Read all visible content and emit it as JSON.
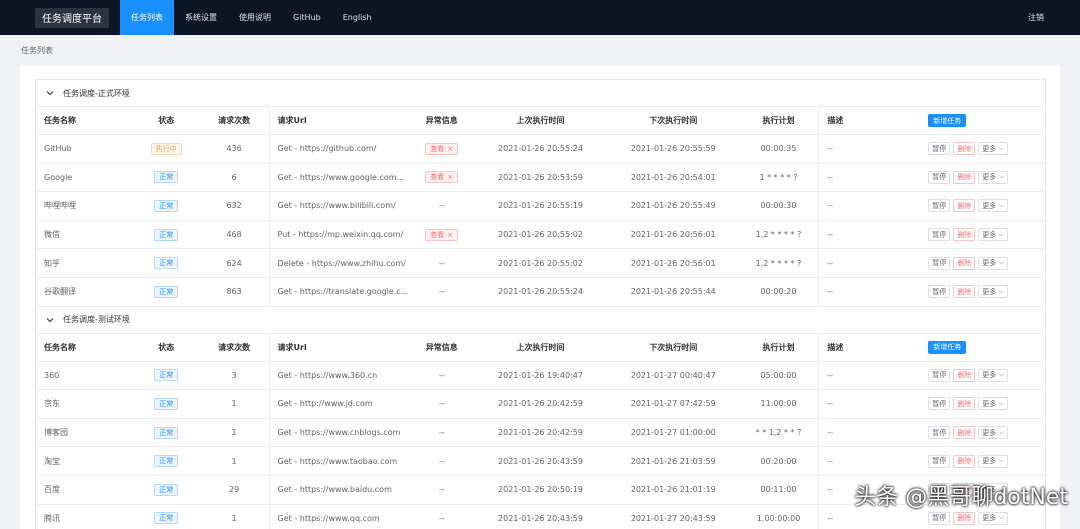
{
  "header": {
    "brand": "任务调度平台",
    "nav": [
      "任务列表",
      "系统设置",
      "使用说明",
      "GitHub",
      "English"
    ],
    "logout": "注销"
  },
  "breadcrumb": "任务列表",
  "columns": [
    "任务名称",
    "状态",
    "请求次数",
    "请求Url",
    "异常信息",
    "上次执行时间",
    "下次执行时间",
    "执行计划",
    "描述"
  ],
  "add_button": "新增任务",
  "actions": {
    "pause": "暂停",
    "delete": "删除",
    "more": "更多"
  },
  "groups": [
    {
      "title": "任务调度-正式环境",
      "rows": [
        {
          "name": "GitHub",
          "status": "执行中",
          "status_type": "run",
          "count": "436",
          "url": "Get - https://github.com/",
          "error": "查看",
          "last": "2021-01-26 20:55:24",
          "next": "2021-01-26 20:55:59",
          "plan": "00:00:35",
          "desc": "--"
        },
        {
          "name": "Google",
          "status": "正常",
          "status_type": "ok",
          "count": "6",
          "url": "Get - https://www.google.com...",
          "error": "查看",
          "last": "2021-01-26 20:53:59",
          "next": "2021-01-26 20:54:01",
          "plan": "1 * * * * ?",
          "desc": "--"
        },
        {
          "name": "哔哩哔哩",
          "status": "正常",
          "status_type": "ok",
          "count": "632",
          "url": "Get - https://www.bilibili.com/",
          "error": "--",
          "last": "2021-01-26 20:55:19",
          "next": "2021-01-26 20:55:49",
          "plan": "00:00:30",
          "desc": "--"
        },
        {
          "name": "微信",
          "status": "正常",
          "status_type": "ok",
          "count": "468",
          "url": "Put - https://mp.weixin.qq.com/",
          "error": "查看",
          "last": "2021-01-26 20:55:02",
          "next": "2021-01-26 20:56:01",
          "plan": "1,2 * * * * ?",
          "desc": "--"
        },
        {
          "name": "知乎",
          "status": "正常",
          "status_type": "ok",
          "count": "624",
          "url": "Delete - https://www.zhihu.com/",
          "error": "--",
          "last": "2021-01-26 20:55:02",
          "next": "2021-01-26 20:56:01",
          "plan": "1,2 * * * * ?",
          "desc": "--"
        },
        {
          "name": "谷歌翻译",
          "status": "正常",
          "status_type": "ok",
          "count": "863",
          "url": "Get - https://translate.google.c...",
          "error": "--",
          "last": "2021-01-26 20:55:24",
          "next": "2021-01-26 20:55:44",
          "plan": "00:00:20",
          "desc": "--"
        }
      ]
    },
    {
      "title": "任务调度-测试环境",
      "rows": [
        {
          "name": "360",
          "status": "正常",
          "status_type": "ok",
          "count": "3",
          "url": "Get - https://www.360.cn",
          "error": "--",
          "last": "2021-01-26 19:40:47",
          "next": "2021-01-27 00:40:47",
          "plan": "05:00:00",
          "desc": "--"
        },
        {
          "name": "京东",
          "status": "正常",
          "status_type": "ok",
          "count": "1",
          "url": "Get - http://www.jd.com",
          "error": "--",
          "last": "2021-01-26 20:42:59",
          "next": "2021-01-27 07:42:59",
          "plan": "11:00:00",
          "desc": "--"
        },
        {
          "name": "博客园",
          "status": "正常",
          "status_type": "ok",
          "count": "1",
          "url": "Get - https://www.cnblogs.com",
          "error": "--",
          "last": "2021-01-26 20:42:59",
          "next": "2021-01-27 01:00:00",
          "plan": "* * 1,2 * * ?",
          "desc": "--"
        },
        {
          "name": "淘宝",
          "status": "正常",
          "status_type": "ok",
          "count": "1",
          "url": "Get - https://www.taobao.com",
          "error": "--",
          "last": "2021-01-26 20:43:59",
          "next": "2021-01-26 21:03:59",
          "plan": "00:20:00",
          "desc": "--"
        },
        {
          "name": "百度",
          "status": "正常",
          "status_type": "ok",
          "count": "29",
          "url": "Get - https://www.baidu.com",
          "error": "--",
          "last": "2021-01-26 20:50:19",
          "next": "2021-01-26 21:01:19",
          "plan": "00:11:00",
          "desc": "--"
        },
        {
          "name": "腾讯",
          "status": "正常",
          "status_type": "ok",
          "count": "1",
          "url": "Get - https://www.qq.com",
          "error": "--",
          "last": "2021-01-26 20:43:59",
          "next": "2021-01-27 20:43:59",
          "plan": "1.00:00:00",
          "desc": "--"
        }
      ]
    }
  ],
  "watermark": "头条 @黑哥聊dotNet"
}
